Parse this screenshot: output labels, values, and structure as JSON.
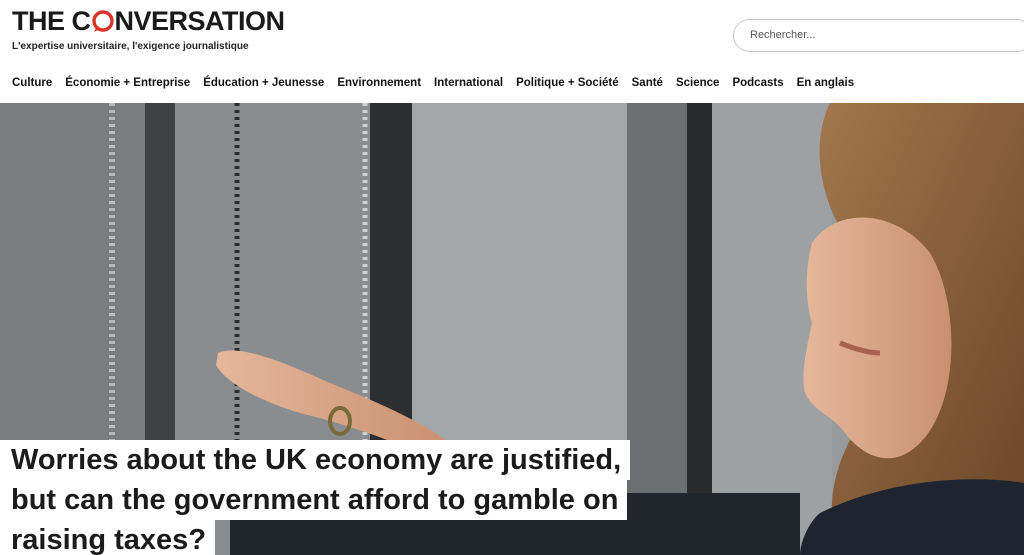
{
  "brand": {
    "logo_text_before": "THE C",
    "logo_text_after": "NVERSATION",
    "tagline": "L'expertise universitaire, l'exigence journalistique",
    "accent_color": "#d8352a"
  },
  "search": {
    "placeholder": "Rechercher..."
  },
  "nav": {
    "items": [
      {
        "label": "Culture"
      },
      {
        "label": "Économie + Entreprise"
      },
      {
        "label": "Éducation + Jeunesse"
      },
      {
        "label": "Environnement"
      },
      {
        "label": "International"
      },
      {
        "label": "Politique + Société"
      },
      {
        "label": "Santé"
      },
      {
        "label": "Science"
      },
      {
        "label": "Podcasts"
      },
      {
        "label": "En anglais"
      }
    ]
  },
  "article": {
    "headline_lines": [
      "Worries about the UK economy are justified,",
      "but can the government afford to gamble on",
      "raising taxes?"
    ]
  }
}
